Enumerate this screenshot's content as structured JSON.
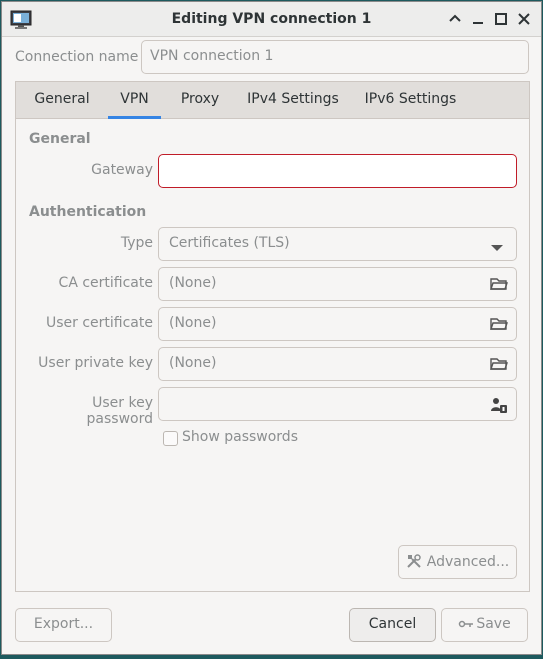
{
  "window": {
    "title": "Editing VPN connection 1"
  },
  "connection": {
    "label": "Connection name",
    "value": "VPN connection 1"
  },
  "tabs": [
    "General",
    "VPN",
    "Proxy",
    "IPv4 Settings",
    "IPv6 Settings"
  ],
  "active_tab": "VPN",
  "vpn": {
    "general_heading": "General",
    "gateway_label": "Gateway",
    "gateway_value": "",
    "auth_heading": "Authentication",
    "type_label": "Type",
    "type_value": "Certificates (TLS)",
    "ca_label": "CA certificate",
    "ca_value": "(None)",
    "user_cert_label": "User certificate",
    "user_cert_value": "(None)",
    "private_key_label": "User private key",
    "private_key_value": "(None)",
    "key_password_label": "User key password",
    "key_password_value": "",
    "show_passwords_label": "Show passwords",
    "advanced_label": "Advanced..."
  },
  "buttons": {
    "export": "Export...",
    "cancel": "Cancel",
    "save": "Save"
  },
  "icons": {
    "app": "network-vpn-icon",
    "minimize": "chevron-up-icon",
    "restore": "minimize-icon",
    "maximize": "maximize-icon",
    "close": "close-icon",
    "folder": "folder-open-icon",
    "password": "user-password-icon",
    "advanced": "tools-icon",
    "save": "save-icon"
  },
  "colors": {
    "accent": "#3584e4",
    "error": "#c01c28",
    "desktop": "#1d5a5e"
  }
}
